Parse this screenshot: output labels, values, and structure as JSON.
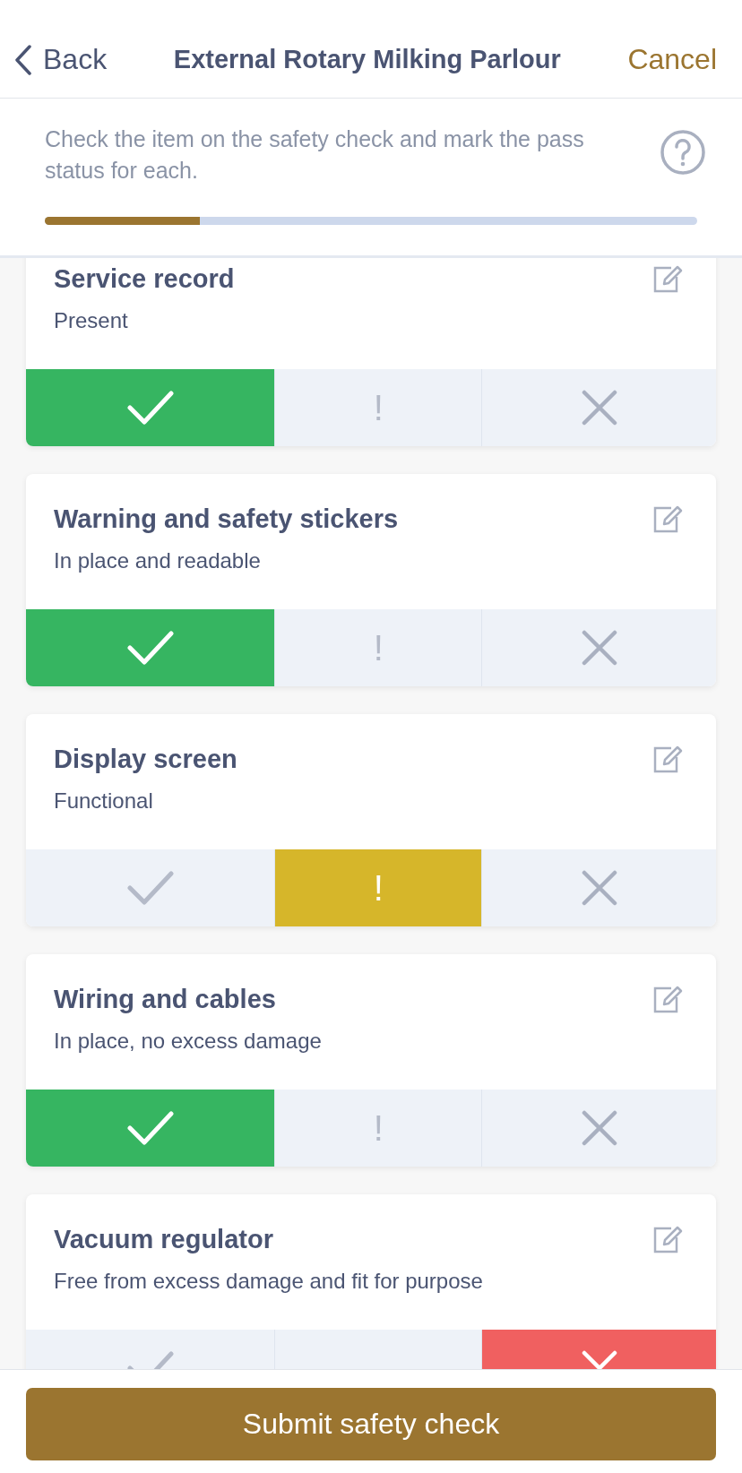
{
  "header": {
    "back": "Back",
    "title": "External Rotary Milking Parlour",
    "cancel": "Cancel"
  },
  "intro": {
    "text": "Check the item on the safety check and mark the pass status for each.",
    "progress": {
      "level": 0.238
    }
  },
  "items": [
    {
      "title": "Service record",
      "detail": "Present",
      "options": [
        {
          "kind": "pass",
          "selected": true
        },
        {
          "kind": "warn",
          "symbol": "!",
          "selected": false
        },
        {
          "kind": "fail",
          "selected": false
        }
      ]
    },
    {
      "title": "Warning and safety stickers",
      "detail": "In place and readable",
      "options": [
        {
          "kind": "pass",
          "selected": true
        },
        {
          "kind": "warn",
          "symbol": "!",
          "selected": false
        },
        {
          "kind": "fail",
          "selected": false
        }
      ]
    },
    {
      "title": "Display screen",
      "detail": "Functional",
      "options": [
        {
          "kind": "pass",
          "selected": false
        },
        {
          "kind": "warn",
          "symbol": "!",
          "selected": true
        },
        {
          "kind": "fail",
          "selected": false
        }
      ]
    },
    {
      "title": "Wiring and cables",
      "detail": "In place, no excess damage",
      "options": [
        {
          "kind": "pass",
          "selected": true
        },
        {
          "kind": "warn",
          "symbol": "!",
          "selected": false
        },
        {
          "kind": "fail",
          "selected": false
        }
      ]
    },
    {
      "title": "Vacuum regulator",
      "detail": "Free from excess damage and fit for purpose",
      "options": [
        {
          "kind": "pass",
          "selected": false
        },
        {
          "kind": "warn",
          "selected": false
        },
        {
          "kind": "fail",
          "selected": true
        }
      ]
    }
  ],
  "submit": "Submit safety check"
}
